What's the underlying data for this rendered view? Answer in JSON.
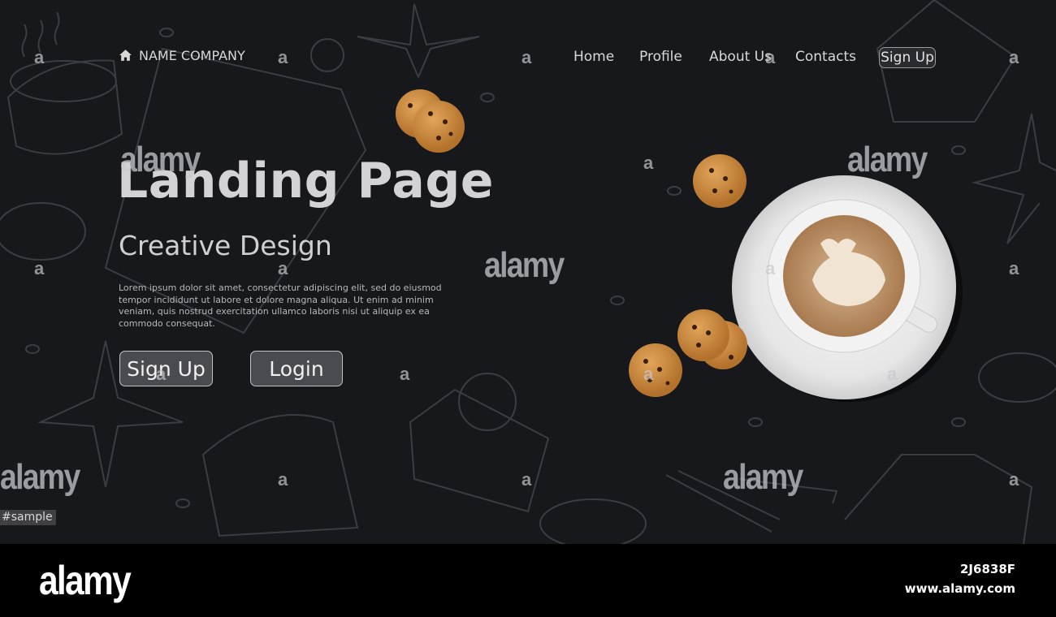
{
  "header": {
    "brand": "NAME COMPANY",
    "nav": [
      "Home",
      "Profile",
      "About Us",
      "Contacts"
    ],
    "signup_label": "Sign Up"
  },
  "hero": {
    "title": "Landing Page",
    "subtitle": "Creative Design",
    "body": "Lorem ipsum dolor sit amet, consectetur adipiscing elit, sed do eiusmod tempor incididunt ut labore et dolore magna aliqua. Ut enim ad minim veniam, quis nostrud exercitation ullamco laboris nisi ut aliquip ex ea commodo consequat.",
    "signup_button": "Sign Up",
    "login_button": "Login"
  },
  "watermark": {
    "word": "alamy",
    "letter": "a",
    "sample_tag": "#sample"
  },
  "footer": {
    "logo": "alamy",
    "image_id": "2J6838F",
    "url": "www.alamy.com"
  },
  "colors": {
    "background": "#17181c",
    "footer": "#000000",
    "text": "#d3d3d5",
    "cookie": "#c98a3e"
  }
}
